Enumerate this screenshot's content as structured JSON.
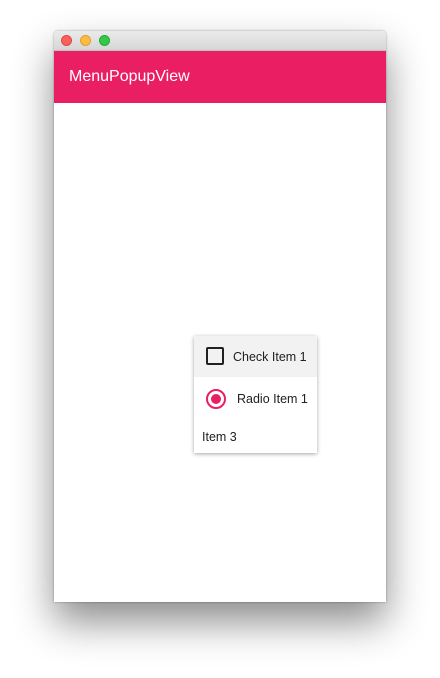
{
  "window": {
    "controls": [
      "close",
      "minimize",
      "maximize"
    ]
  },
  "appbar": {
    "title": "MenuPopupView",
    "color": "#e91e63"
  },
  "popup_menu": {
    "items": [
      {
        "type": "check",
        "label": "Check Item 1",
        "checked": false,
        "icon": "checkbox-icon"
      },
      {
        "type": "radio",
        "label": "Radio Item 1",
        "checked": true,
        "icon": "radio-icon"
      },
      {
        "type": "plain",
        "label": "Item 3"
      }
    ]
  }
}
